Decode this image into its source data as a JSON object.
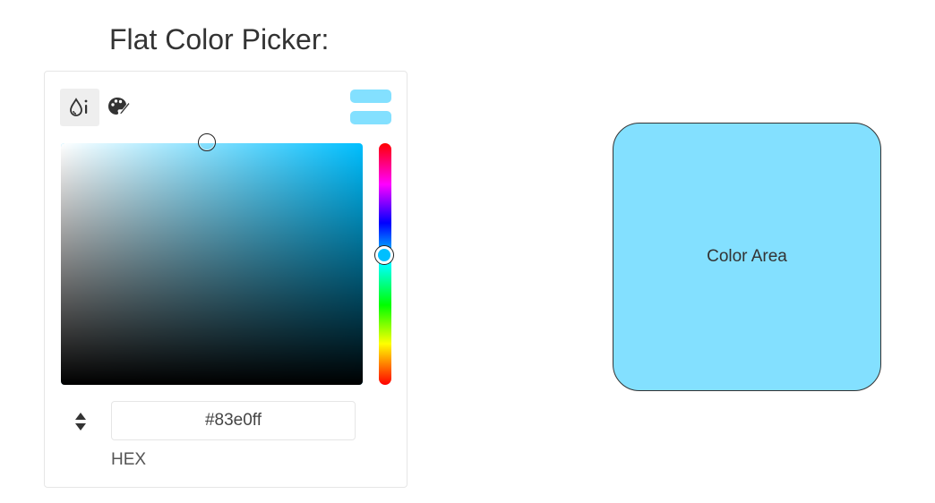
{
  "page": {
    "title": "Flat Color Picker:"
  },
  "picker": {
    "mode_tabs": [
      {
        "icon": "drop-icon",
        "active": true
      },
      {
        "icon": "palette-icon",
        "active": false
      }
    ],
    "current_color": "#83e0ff",
    "hue_color": "#00bfff",
    "hex_value": "#83e0ff",
    "format_label": "HEX"
  },
  "preview": {
    "label": "Color Area",
    "color": "#83e0ff"
  }
}
